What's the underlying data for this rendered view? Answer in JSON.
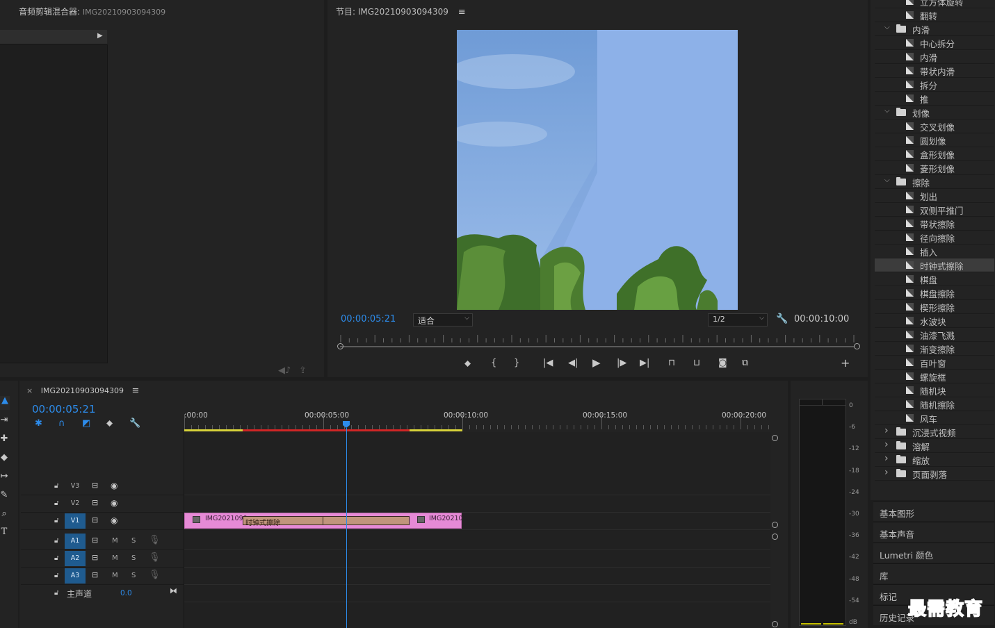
{
  "source_panel": {
    "title_prefix": "音频剪辑混合器:",
    "title_clip": "IMG20210903094309"
  },
  "program_monitor": {
    "title": "节目: IMG20210903094309",
    "timecode_current": "00:00:05:21",
    "fit_select": "适合",
    "resolution_select": "1/2",
    "timecode_duration": "00:00:10:00",
    "playhead_fraction": 0.58
  },
  "effects_tree": {
    "rows": [
      {
        "type": "fx",
        "label": "立方体旋转"
      },
      {
        "type": "fx",
        "label": "翻转"
      },
      {
        "type": "folder",
        "label": "内滑",
        "open": true
      },
      {
        "type": "fx",
        "label": "中心拆分"
      },
      {
        "type": "fx",
        "label": "内滑"
      },
      {
        "type": "fx",
        "label": "带状内滑"
      },
      {
        "type": "fx",
        "label": "拆分"
      },
      {
        "type": "fx",
        "label": "推"
      },
      {
        "type": "folder",
        "label": "划像",
        "open": true
      },
      {
        "type": "fx",
        "label": "交叉划像"
      },
      {
        "type": "fx",
        "label": "圆划像"
      },
      {
        "type": "fx",
        "label": "盒形划像"
      },
      {
        "type": "fx",
        "label": "菱形划像"
      },
      {
        "type": "folder",
        "label": "擦除",
        "open": true
      },
      {
        "type": "fx",
        "label": "划出"
      },
      {
        "type": "fx",
        "label": "双侧平推门"
      },
      {
        "type": "fx",
        "label": "带状擦除"
      },
      {
        "type": "fx",
        "label": "径向擦除"
      },
      {
        "type": "fx",
        "label": "插入"
      },
      {
        "type": "fx",
        "label": "时钟式擦除",
        "selected": true
      },
      {
        "type": "fx",
        "label": "棋盘"
      },
      {
        "type": "fx",
        "label": "棋盘擦除"
      },
      {
        "type": "fx",
        "label": "楔形擦除"
      },
      {
        "type": "fx",
        "label": "水波块"
      },
      {
        "type": "fx",
        "label": "油漆飞溅"
      },
      {
        "type": "fx",
        "label": "渐变擦除"
      },
      {
        "type": "fx",
        "label": "百叶窗"
      },
      {
        "type": "fx",
        "label": "螺旋框"
      },
      {
        "type": "fx",
        "label": "随机块"
      },
      {
        "type": "fx",
        "label": "随机擦除"
      },
      {
        "type": "fx",
        "label": "风车"
      },
      {
        "type": "folder",
        "label": "沉浸式视频",
        "open": false
      },
      {
        "type": "folder",
        "label": "溶解",
        "open": false
      },
      {
        "type": "folder",
        "label": "缩放",
        "open": false
      },
      {
        "type": "folder",
        "label": "页面剥落",
        "open": false
      }
    ]
  },
  "side_panels": [
    "基本图形",
    "基本声音",
    "Lumetri 颜色",
    "库",
    "标记",
    "历史记录"
  ],
  "timeline": {
    "tab_close": "×",
    "sequence_name": "IMG20210903094309",
    "timecode": "00:00:05:21",
    "ruler_labels": [
      ":00:00",
      "00:00:05:00",
      "00:00:10:00",
      "00:00:15:00",
      "00:00:20:00"
    ],
    "video_tracks": [
      {
        "label": "V3",
        "active": false
      },
      {
        "label": "V2",
        "active": false
      },
      {
        "label": "V1",
        "active": true
      }
    ],
    "audio_tracks": [
      {
        "label": "A1",
        "mute": "M",
        "solo": "S"
      },
      {
        "label": "A2",
        "mute": "M",
        "solo": "S"
      },
      {
        "label": "A3",
        "mute": "M",
        "solo": "S"
      }
    ],
    "master": {
      "label": "主声道",
      "value": "0.0"
    },
    "clip_left_name": "IMG2021090",
    "transition_name": "时钟式擦除",
    "clip_right_name": "IMG20210"
  },
  "audio_meter": {
    "scale": [
      "0",
      "-6",
      "-12",
      "-18",
      "-24",
      "-30",
      "-36",
      "-42",
      "-48",
      "-54",
      "dB"
    ]
  },
  "watermark": "最需教育",
  "colors": {
    "accent_blue": "#2d8ceb",
    "clip_pink": "#e68ad6",
    "transition_tan": "#c1957c",
    "work_area_yellow": "#d7d23a",
    "render_red": "#d02525",
    "selection": "#3c3c3c"
  }
}
